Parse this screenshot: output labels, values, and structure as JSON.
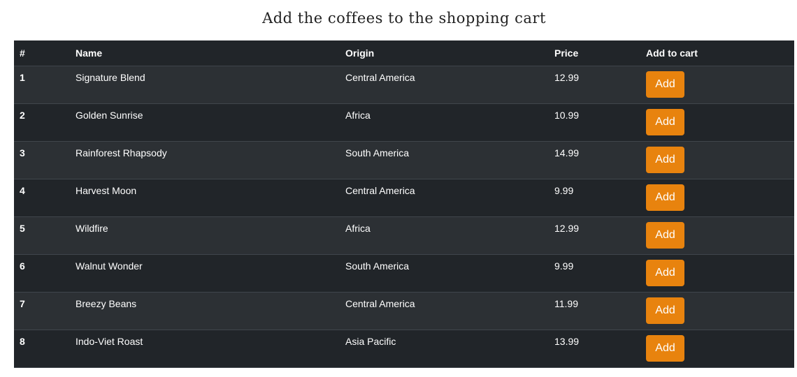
{
  "page": {
    "title": "Add the coffees to the shopping cart"
  },
  "table": {
    "headers": {
      "num": "#",
      "name": "Name",
      "origin": "Origin",
      "price": "Price",
      "add": "Add to cart"
    },
    "rows": [
      {
        "num": "1",
        "name": "Signature Blend",
        "origin": "Central America",
        "price": "12.99",
        "button": "Add"
      },
      {
        "num": "2",
        "name": "Golden Sunrise",
        "origin": "Africa",
        "price": "10.99",
        "button": "Add"
      },
      {
        "num": "3",
        "name": "Rainforest Rhapsody",
        "origin": "South America",
        "price": "14.99",
        "button": "Add"
      },
      {
        "num": "4",
        "name": "Harvest Moon",
        "origin": "Central America",
        "price": "9.99",
        "button": "Add"
      },
      {
        "num": "5",
        "name": "Wildfire",
        "origin": "Africa",
        "price": "12.99",
        "button": "Add"
      },
      {
        "num": "6",
        "name": "Walnut Wonder",
        "origin": "South America",
        "price": "9.99",
        "button": "Add"
      },
      {
        "num": "7",
        "name": "Breezy Beans",
        "origin": "Central America",
        "price": "11.99",
        "button": "Add"
      },
      {
        "num": "8",
        "name": "Indo-Viet Roast",
        "origin": "Asia Pacific",
        "price": "13.99",
        "button": "Add"
      }
    ]
  },
  "colors": {
    "button": "#e8830e",
    "table_dark": "#212529",
    "table_stripe": "#2c3034",
    "text": "#ffffff"
  }
}
